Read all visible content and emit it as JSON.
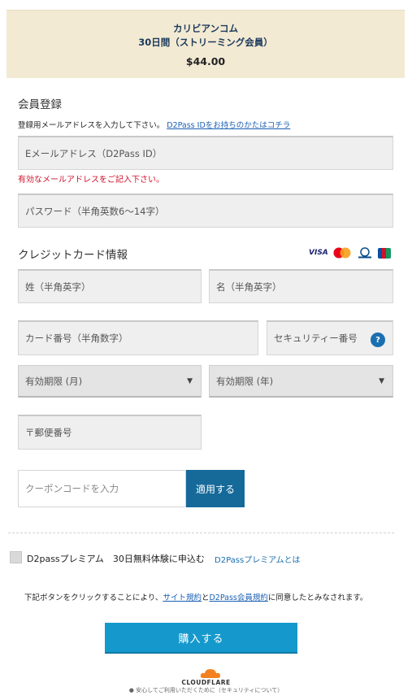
{
  "summary": {
    "line1": "カリビアンコム",
    "line2": "30日間（ストリーミング会員）",
    "price": "$44.00"
  },
  "registration": {
    "title": "会員登録",
    "instruction": "登録用メールアドレスを入力して下さい。",
    "d2pass_link": "D2Pass IDをお持ちのかたはコチラ",
    "email_placeholder": "Eメールアドレス（D2Pass ID）",
    "email_error": "有効なメールアドレスをご記入下さい。",
    "password_placeholder": "パスワード（半角英数6～14字）"
  },
  "card": {
    "title": "クレジットカード情報",
    "brands": [
      "VISA",
      "Mastercard",
      "Diners Club",
      "JCB"
    ],
    "last_name_placeholder": "姓（半角英字）",
    "first_name_placeholder": "名（半角英字）",
    "number_placeholder": "カード番号（半角数字）",
    "security_placeholder": "セキュリティー番号",
    "security_help": "?",
    "exp_month": "有効期限 (月)",
    "exp_year": "有効期限 (年)",
    "zip_placeholder": "〒郵便番号"
  },
  "coupon": {
    "placeholder": "クーポンコードを入力",
    "apply_label": "適用する"
  },
  "premium": {
    "checkbox_label": "D2passプレミアム　30日無料体験に申込む",
    "link": "D2Passプレミアムとは"
  },
  "terms": {
    "prefix": "下記ボタンをクリックすることにより、",
    "site_terms": "サイト規約",
    "and": "と",
    "d2pass_terms": "D2Pass会員規約",
    "suffix": "に同意したとみなされます。"
  },
  "buy_button": "購入する",
  "cloudflare": {
    "brand": "CLOUDFLARE",
    "note": "安心してご利用いただくために（セキュリティについて）"
  },
  "colors": {
    "summary_bg": "#f3ead3",
    "accent": "#1599cc",
    "error": "#d0102b",
    "link": "#1a5fb4"
  }
}
